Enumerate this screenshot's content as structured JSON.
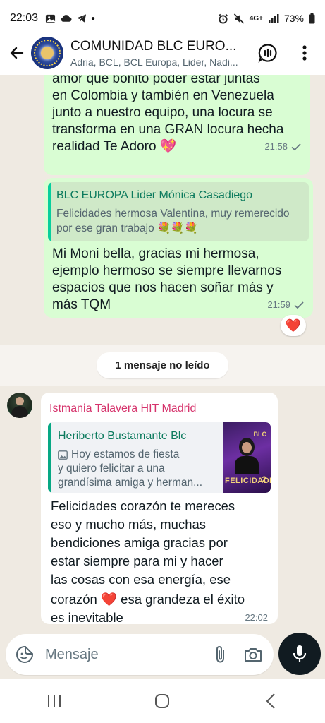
{
  "status_bar": {
    "time": "22:03",
    "network": "4G+",
    "battery": "73%"
  },
  "header": {
    "title": "COMUNIDAD BLC EURO...",
    "subtitle": "Adria, BCL, BCL Europa, Lider, Nadi..."
  },
  "messages": {
    "out1": {
      "text_lines": [
        "amor que bonito poder estar juntas",
        "en Colombia y también en Venezuela",
        "junto a nuestro equipo,  una locura se",
        "transforma en una GRAN locura hecha",
        "realidad Te Adoro"
      ],
      "emoji": "💖",
      "time": "21:58"
    },
    "out2": {
      "quote_name": "BLC EUROPA Lider Mónica Casadiego",
      "quote_text": "Felicidades hermosa Valentina, muy remerecido por ese gran trabajo",
      "quote_emojis": "💐💐💐",
      "text_lines": [
        "Mi Moni bella, gracias mi hermosa,",
        "ejemplo hermoso se siempre llevarnos",
        "espacios que nos hacen soñar más y",
        "más TQM"
      ],
      "time": "21:59",
      "reaction": "❤️"
    },
    "unread_label": "1 mensaje no leído",
    "in1": {
      "sender": "Istmania Talavera HIT Madrid",
      "quote_name": "Heriberto Bustamante Blc",
      "quote_icon": "image-icon",
      "quote_text_line1": "Hoy estamos de fiesta",
      "quote_text_line2": "y quiero felicitar a una",
      "quote_text_line3": "grandísima amiga y herman...",
      "thumb_brand": "BLC",
      "thumb_word": "FELICIDADES",
      "thumb_num": "2",
      "text_lines": [
        "Felicidades  corazón  te mereces",
        "eso y mucho más, muchas",
        "bendiciones  amiga gracias  por",
        "estar siempre para mi y  hacer",
        "las cosas con esa energía,   ese"
      ],
      "line6_a": "corazón",
      "line6_emoji": "❤️",
      "line6_b": "esa grandeza el éxito",
      "last_line": "es inevitable",
      "time": "22:02"
    }
  },
  "composer": {
    "placeholder": "Mensaje"
  },
  "colors": {
    "outgoing_bubble": "#d9fdd3",
    "chat_bg": "#efeae2",
    "sender_name": "#d6336c",
    "accent": "#06cf9c"
  }
}
